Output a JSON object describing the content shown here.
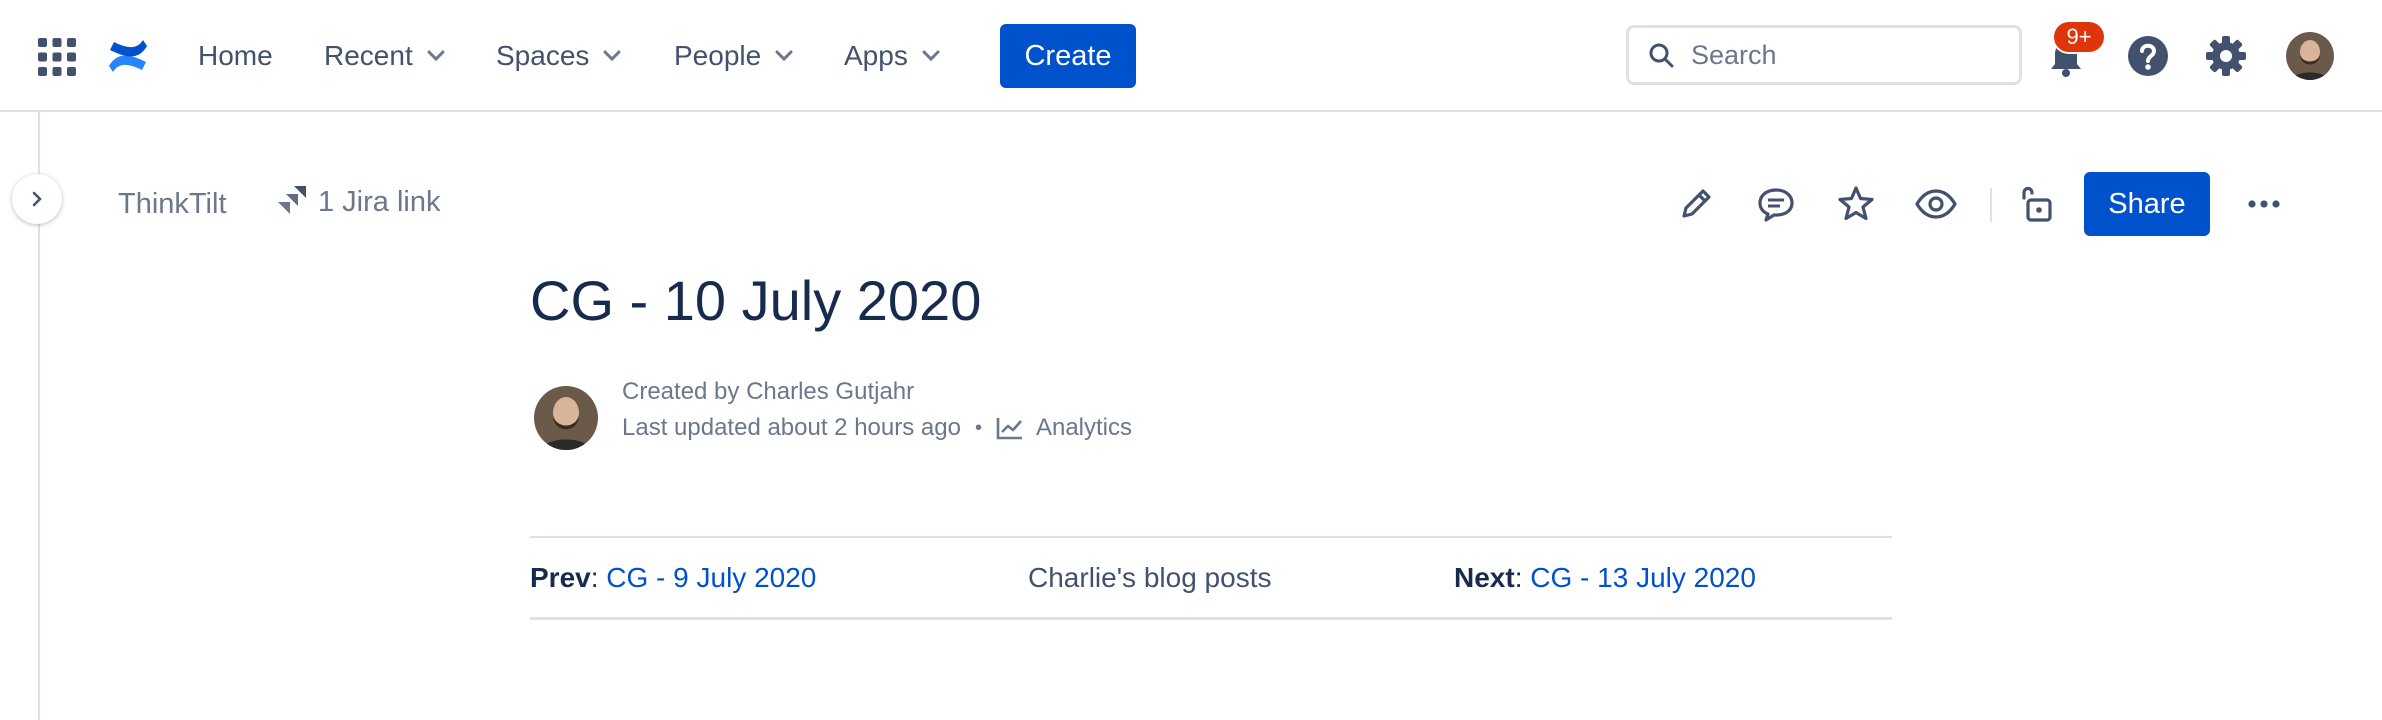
{
  "nav": {
    "items": [
      {
        "label": "Home",
        "has_dropdown": false
      },
      {
        "label": "Recent",
        "has_dropdown": true
      },
      {
        "label": "Spaces",
        "has_dropdown": true
      },
      {
        "label": "People",
        "has_dropdown": true
      },
      {
        "label": "Apps",
        "has_dropdown": true
      }
    ],
    "create_label": "Create",
    "search_placeholder": "Search",
    "notifications_badge": "9+"
  },
  "page_header": {
    "space": "ThinkTilt",
    "jira_link": "1 Jira link",
    "share_label": "Share"
  },
  "content": {
    "title": "CG - 10 July 2020",
    "created_by": "Created by Charles Gutjahr",
    "last_updated": "Last updated about 2 hours ago",
    "analytics_label": "Analytics",
    "prev_label": "Prev",
    "prev_link": "CG - 9 July 2020",
    "center_link": "Charlie's blog posts",
    "next_label": "Next",
    "next_link": "CG - 13 July 2020"
  },
  "colors": {
    "brand_blue": "#0052cc",
    "text_primary": "#172b4d",
    "text_subtle": "#6b778c",
    "badge_red": "#de350b"
  },
  "icons": [
    "app-switcher-icon",
    "confluence-logo-icon",
    "chevron-down-icon",
    "search-icon",
    "bell-icon",
    "help-icon",
    "gear-icon",
    "chevron-right-icon",
    "jira-icon",
    "edit-icon",
    "comment-icon",
    "star-icon",
    "watch-icon",
    "unlock-icon",
    "more-icon",
    "analytics-icon"
  ]
}
